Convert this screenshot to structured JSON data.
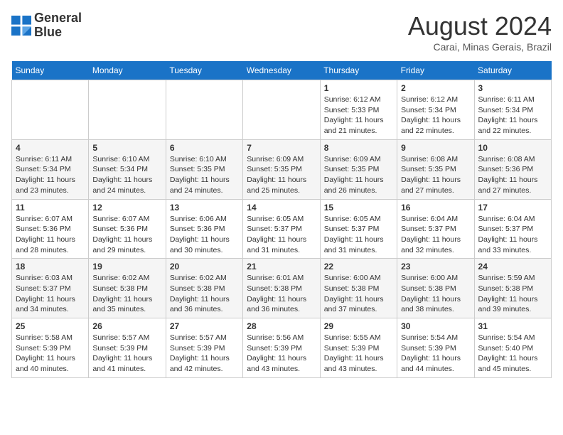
{
  "logo": {
    "line1": "General",
    "line2": "Blue"
  },
  "title": "August 2024",
  "location": "Carai, Minas Gerais, Brazil",
  "days_of_week": [
    "Sunday",
    "Monday",
    "Tuesday",
    "Wednesday",
    "Thursday",
    "Friday",
    "Saturday"
  ],
  "weeks": [
    [
      {
        "day": "",
        "info": ""
      },
      {
        "day": "",
        "info": ""
      },
      {
        "day": "",
        "info": ""
      },
      {
        "day": "",
        "info": ""
      },
      {
        "day": "1",
        "sunrise": "6:12 AM",
        "sunset": "5:33 PM",
        "daylight": "11 hours and 21 minutes."
      },
      {
        "day": "2",
        "sunrise": "6:12 AM",
        "sunset": "5:34 PM",
        "daylight": "11 hours and 22 minutes."
      },
      {
        "day": "3",
        "sunrise": "6:11 AM",
        "sunset": "5:34 PM",
        "daylight": "11 hours and 22 minutes."
      }
    ],
    [
      {
        "day": "4",
        "sunrise": "6:11 AM",
        "sunset": "5:34 PM",
        "daylight": "11 hours and 23 minutes."
      },
      {
        "day": "5",
        "sunrise": "6:10 AM",
        "sunset": "5:34 PM",
        "daylight": "11 hours and 24 minutes."
      },
      {
        "day": "6",
        "sunrise": "6:10 AM",
        "sunset": "5:35 PM",
        "daylight": "11 hours and 24 minutes."
      },
      {
        "day": "7",
        "sunrise": "6:09 AM",
        "sunset": "5:35 PM",
        "daylight": "11 hours and 25 minutes."
      },
      {
        "day": "8",
        "sunrise": "6:09 AM",
        "sunset": "5:35 PM",
        "daylight": "11 hours and 26 minutes."
      },
      {
        "day": "9",
        "sunrise": "6:08 AM",
        "sunset": "5:35 PM",
        "daylight": "11 hours and 27 minutes."
      },
      {
        "day": "10",
        "sunrise": "6:08 AM",
        "sunset": "5:36 PM",
        "daylight": "11 hours and 27 minutes."
      }
    ],
    [
      {
        "day": "11",
        "sunrise": "6:07 AM",
        "sunset": "5:36 PM",
        "daylight": "11 hours and 28 minutes."
      },
      {
        "day": "12",
        "sunrise": "6:07 AM",
        "sunset": "5:36 PM",
        "daylight": "11 hours and 29 minutes."
      },
      {
        "day": "13",
        "sunrise": "6:06 AM",
        "sunset": "5:36 PM",
        "daylight": "11 hours and 30 minutes."
      },
      {
        "day": "14",
        "sunrise": "6:05 AM",
        "sunset": "5:37 PM",
        "daylight": "11 hours and 31 minutes."
      },
      {
        "day": "15",
        "sunrise": "6:05 AM",
        "sunset": "5:37 PM",
        "daylight": "11 hours and 31 minutes."
      },
      {
        "day": "16",
        "sunrise": "6:04 AM",
        "sunset": "5:37 PM",
        "daylight": "11 hours and 32 minutes."
      },
      {
        "day": "17",
        "sunrise": "6:04 AM",
        "sunset": "5:37 PM",
        "daylight": "11 hours and 33 minutes."
      }
    ],
    [
      {
        "day": "18",
        "sunrise": "6:03 AM",
        "sunset": "5:37 PM",
        "daylight": "11 hours and 34 minutes."
      },
      {
        "day": "19",
        "sunrise": "6:02 AM",
        "sunset": "5:38 PM",
        "daylight": "11 hours and 35 minutes."
      },
      {
        "day": "20",
        "sunrise": "6:02 AM",
        "sunset": "5:38 PM",
        "daylight": "11 hours and 36 minutes."
      },
      {
        "day": "21",
        "sunrise": "6:01 AM",
        "sunset": "5:38 PM",
        "daylight": "11 hours and 36 minutes."
      },
      {
        "day": "22",
        "sunrise": "6:00 AM",
        "sunset": "5:38 PM",
        "daylight": "11 hours and 37 minutes."
      },
      {
        "day": "23",
        "sunrise": "6:00 AM",
        "sunset": "5:38 PM",
        "daylight": "11 hours and 38 minutes."
      },
      {
        "day": "24",
        "sunrise": "5:59 AM",
        "sunset": "5:38 PM",
        "daylight": "11 hours and 39 minutes."
      }
    ],
    [
      {
        "day": "25",
        "sunrise": "5:58 AM",
        "sunset": "5:39 PM",
        "daylight": "11 hours and 40 minutes."
      },
      {
        "day": "26",
        "sunrise": "5:57 AM",
        "sunset": "5:39 PM",
        "daylight": "11 hours and 41 minutes."
      },
      {
        "day": "27",
        "sunrise": "5:57 AM",
        "sunset": "5:39 PM",
        "daylight": "11 hours and 42 minutes."
      },
      {
        "day": "28",
        "sunrise": "5:56 AM",
        "sunset": "5:39 PM",
        "daylight": "11 hours and 43 minutes."
      },
      {
        "day": "29",
        "sunrise": "5:55 AM",
        "sunset": "5:39 PM",
        "daylight": "11 hours and 43 minutes."
      },
      {
        "day": "30",
        "sunrise": "5:54 AM",
        "sunset": "5:39 PM",
        "daylight": "11 hours and 44 minutes."
      },
      {
        "day": "31",
        "sunrise": "5:54 AM",
        "sunset": "5:40 PM",
        "daylight": "11 hours and 45 minutes."
      }
    ]
  ]
}
